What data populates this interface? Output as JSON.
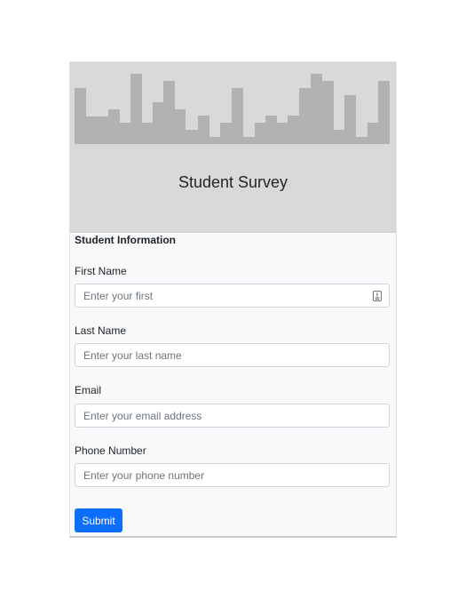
{
  "banner": {
    "title": "Student Survey"
  },
  "form": {
    "section_title": "Student Information",
    "fields": [
      {
        "label": "First Name",
        "placeholder": "Enter your first",
        "value": ""
      },
      {
        "label": "Last Name",
        "placeholder": "Enter your last name",
        "value": ""
      },
      {
        "label": "Email",
        "placeholder": "Enter your email address",
        "value": ""
      },
      {
        "label": "Phone Number",
        "placeholder": "Enter your phone number",
        "value": ""
      }
    ],
    "submit_label": "Submit"
  },
  "icons": {
    "first_name_field_icon": "autofill-icon",
    "banner_graphic": "city-skyline-icon"
  },
  "colors": {
    "primary": "#0d6efd",
    "banner_background": "#d9d9d9",
    "skyline": "#b1b2b4",
    "card_background": "#f8f9fa",
    "input_border": "#ced4da",
    "placeholder": "#6c757d"
  }
}
